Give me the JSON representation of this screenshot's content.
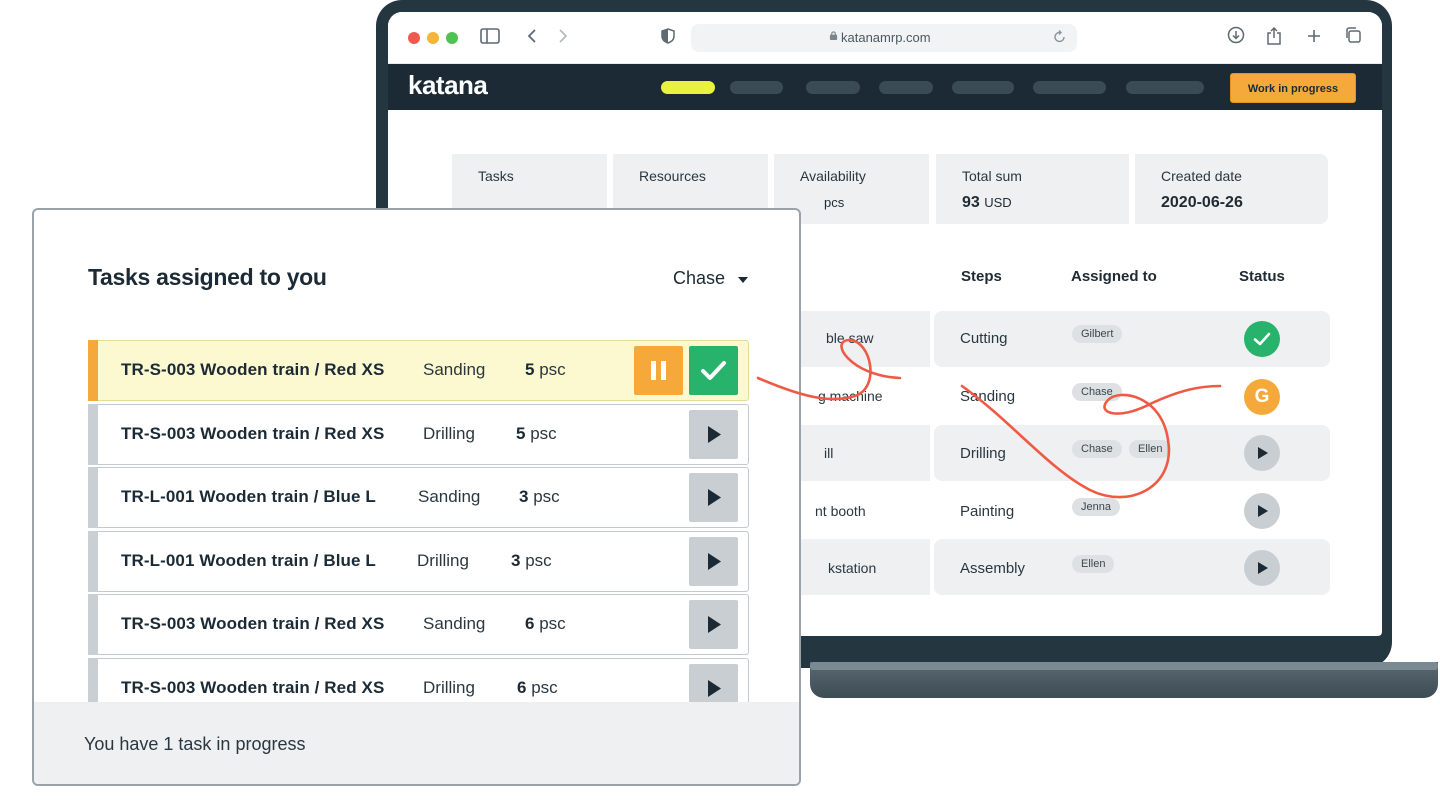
{
  "browser": {
    "url": "katanamrp.com"
  },
  "app": {
    "logo": "katana",
    "work_in_progress_label": "Work in progress"
  },
  "summary": [
    {
      "label": "Tasks",
      "value": "",
      "unit": ""
    },
    {
      "label": "Resources",
      "value": "",
      "unit": ""
    },
    {
      "label": "Availability",
      "value": "",
      "unit": "pcs"
    },
    {
      "label": "Total sum",
      "value": "93",
      "unit": "USD"
    },
    {
      "label": "Created date",
      "value": "2020-06-26",
      "unit": ""
    }
  ],
  "table": {
    "headers": {
      "steps": "Steps",
      "assigned_to": "Assigned to",
      "status": "Status"
    },
    "rows": [
      {
        "resource": "ble saw",
        "step": "Cutting",
        "assignees": [
          "Gilbert"
        ],
        "status": "done"
      },
      {
        "resource": "g machine",
        "step": "Sanding",
        "assignees": [
          "Chase"
        ],
        "status": "in-progress",
        "status_glyph": "G"
      },
      {
        "resource": "ill",
        "step": "Drilling",
        "assignees": [
          "Chase",
          "Ellen"
        ],
        "status": "not-started"
      },
      {
        "resource": "nt booth",
        "step": "Painting",
        "assignees": [
          "Jenna"
        ],
        "status": "not-started"
      },
      {
        "resource": "kstation",
        "step": "Assembly",
        "assignees": [
          "Ellen"
        ],
        "status": "not-started"
      }
    ]
  },
  "tasks_card": {
    "title": "Tasks assigned to you",
    "filter_value": "Chase",
    "tasks": [
      {
        "name": "TR-S-003 Wooden train / Red XS",
        "step": "Sanding",
        "qty": "5",
        "unit": "psc",
        "state": "in-progress"
      },
      {
        "name": "TR-S-003 Wooden train / Red XS",
        "step": "Drilling",
        "qty": "5",
        "unit": "psc",
        "state": "not-started"
      },
      {
        "name": "TR-L-001 Wooden train / Blue L",
        "step": "Sanding",
        "qty": "3",
        "unit": "psc",
        "state": "not-started"
      },
      {
        "name": "TR-L-001 Wooden train / Blue L",
        "step": "Drilling",
        "qty": "3",
        "unit": "psc",
        "state": "not-started"
      },
      {
        "name": "TR-S-003 Wooden train / Red XS",
        "step": "Sanding",
        "qty": "6",
        "unit": "psc",
        "state": "not-started"
      },
      {
        "name": "TR-S-003 Wooden train / Red XS",
        "step": "Drilling",
        "qty": "6",
        "unit": "psc",
        "state": "not-started"
      }
    ],
    "footer": "You have 1 task in progress"
  },
  "colors": {
    "accent_yellow": "#e8f23f",
    "wip_orange": "#f6a93b",
    "done_green": "#27b36b",
    "navy": "#1b2a34",
    "scribble_red": "#ef5a45"
  }
}
